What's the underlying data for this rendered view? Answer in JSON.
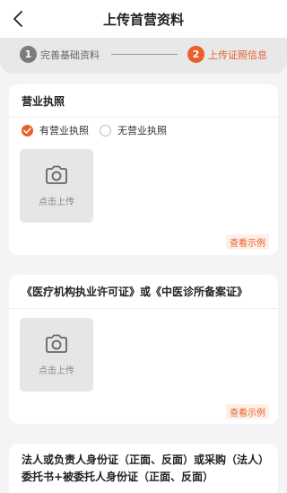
{
  "header": {
    "title": "上传首营资料"
  },
  "steps": [
    {
      "number": "1",
      "label": "完善基础资料"
    },
    {
      "number": "2",
      "label": "上传证照信息"
    }
  ],
  "cards": [
    {
      "title": "营业执照",
      "options": [
        "有营业执照",
        "无营业执照"
      ],
      "selected_option": "有营业执照",
      "upload_label": "点击上传",
      "example_link": "查看示例"
    },
    {
      "title": "《医疗机构执业许可证》或《中医诊所备案证》",
      "upload_label": "点击上传",
      "example_link": "查看示例"
    },
    {
      "title": "法人或负责人身份证（正面、反面）或采购（法人）委托书+被委托人身份证（正面、反面）"
    }
  ],
  "colors": {
    "accent": "#e8612c",
    "step_inactive": "#7c7c7c",
    "background": "#f4f4f6"
  },
  "icons": {
    "back": "chevron-left-icon",
    "camera": "camera-icon"
  }
}
